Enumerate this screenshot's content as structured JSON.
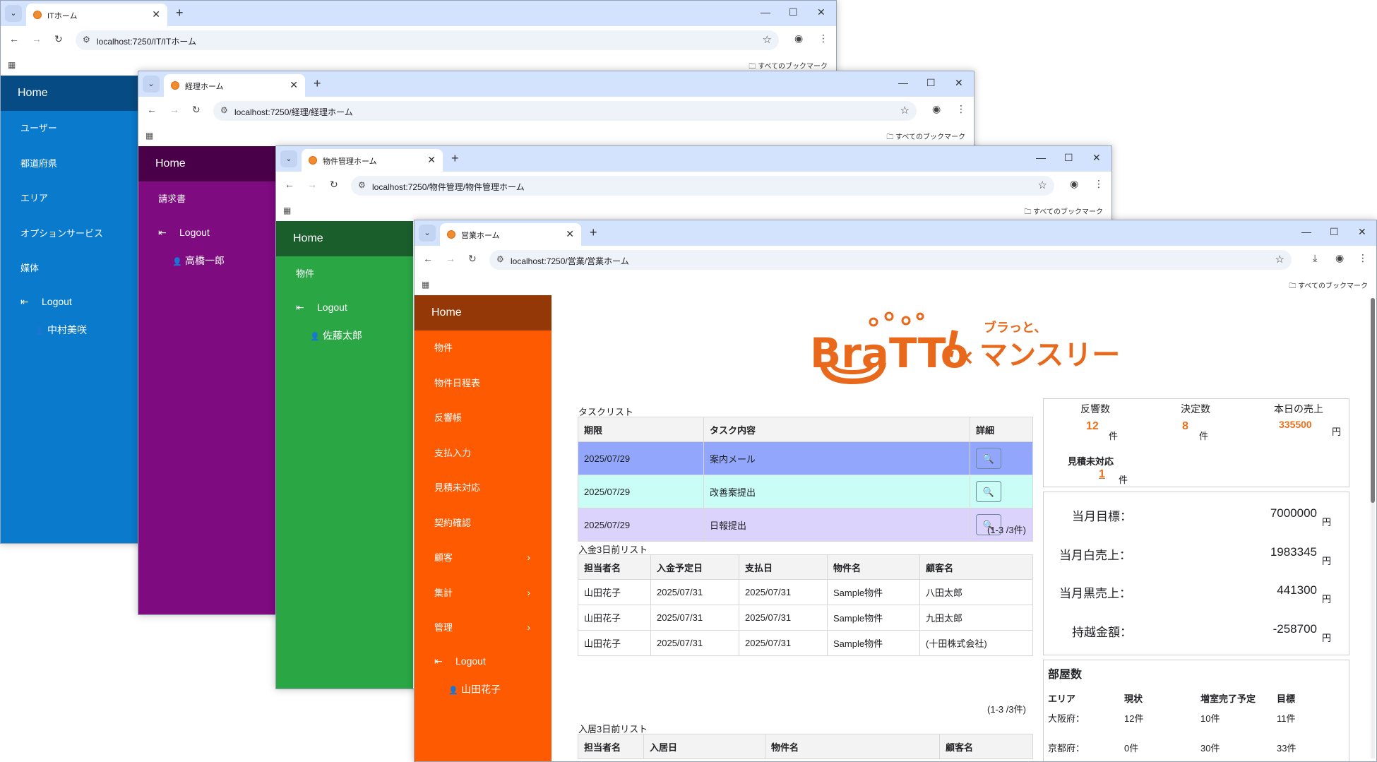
{
  "browser": {
    "bookmarks_label": "すべてのブックマーク",
    "new_tab": "+",
    "close": "✕",
    "minimize": "—",
    "maximize": "☐",
    "window_close": "✕",
    "dropdown": "⌄"
  },
  "windows": [
    {
      "tab_title": "ITホーム",
      "url": "localhost:7250/IT/ITホーム",
      "sidebar_color": "#0a7acc",
      "home_color": "#074b84",
      "home": "Home",
      "items": [
        "ユーザー",
        "都道府県",
        "エリア",
        "オプションサービス",
        "媒体"
      ],
      "logout": "Logout",
      "user": "中村美咲"
    },
    {
      "tab_title": "経理ホーム",
      "url": "localhost:7250/経理/経理ホーム",
      "sidebar_color": "#7e0b80",
      "home_color": "#4a0048",
      "home": "Home",
      "items": [
        "請求書"
      ],
      "logout": "Logout",
      "user": "高橋一郎"
    },
    {
      "tab_title": "物件管理ホーム",
      "url": "localhost:7250/物件管理/物件管理ホーム",
      "sidebar_color": "#2aa645",
      "home_color": "#1a5e2c",
      "home": "Home",
      "items": [
        "物件"
      ],
      "logout": "Logout",
      "user": "佐藤太郎"
    },
    {
      "tab_title": "営業ホーム",
      "url": "localhost:7250/営業/営業ホーム",
      "sidebar_color": "#fe5a02",
      "home_color": "#933806",
      "home": "Home",
      "items": [
        "物件",
        "物件日程表",
        "反響帳",
        "支払入力",
        "見積未対応",
        "契約確認"
      ],
      "expandable_items": [
        "顧客",
        "集計",
        "管理"
      ],
      "logout": "Logout",
      "user": "山田花子"
    }
  ],
  "logo": {
    "brand": "BraTTo",
    "mark": "!",
    "times": "×",
    "tagline": "ブラっと、",
    "product": "マンスリー"
  },
  "task_list": {
    "title": "タスクリスト",
    "headers": [
      "期限",
      "タスク内容",
      "詳細"
    ],
    "rows": [
      {
        "date": "2025/07/29",
        "task": "案内メール",
        "color": "#92a7fc"
      },
      {
        "date": "2025/07/29",
        "task": "改善案提出",
        "color": "#c9fdf5"
      },
      {
        "date": "2025/07/29",
        "task": "日報提出",
        "color": "#dcd3fd"
      }
    ],
    "count": "(1-3 /3件)"
  },
  "payment_list": {
    "title": "入金3日前リスト",
    "headers": [
      "担当者名",
      "入金予定日",
      "支払日",
      "物件名",
      "顧客名"
    ],
    "rows": [
      [
        "山田花子",
        "2025/07/31",
        "2025/07/31",
        "Sample物件",
        "八田太郎"
      ],
      [
        "山田花子",
        "2025/07/31",
        "2025/07/31",
        "Sample物件",
        "九田太郎"
      ],
      [
        "山田花子",
        "2025/07/31",
        "2025/07/31",
        "Sample物件",
        "(十田株式会社)"
      ]
    ],
    "count": "(1-3 /3件)"
  },
  "movein_list": {
    "title": "入居3日前リスト",
    "headers": [
      "担当者名",
      "入居日",
      "物件名",
      "顧客名"
    ]
  },
  "stats": {
    "response_label": "反響数",
    "response_value": "12",
    "response_unit": "件",
    "decided_label": "決定数",
    "decided_value": "8",
    "decided_unit": "件",
    "sales_label": "本日の売上",
    "sales_value": "335500",
    "sales_unit": "円",
    "estimate_label": "見積未対応",
    "estimate_value": "1",
    "estimate_unit": "件"
  },
  "goals": [
    {
      "label": "当月目標：",
      "value": "7000000",
      "unit": "円"
    },
    {
      "label": "当月白売上：",
      "value": "1983345",
      "unit": "円"
    },
    {
      "label": "当月黒売上：",
      "value": "441300",
      "unit": "円"
    },
    {
      "label": "持越金額：",
      "value": "-258700",
      "unit": "円"
    }
  ],
  "rooms": {
    "title": "部屋数",
    "headers": [
      "エリア",
      "現状",
      "増室完了予定",
      "目標"
    ],
    "rows": [
      [
        "大阪府：",
        "12件",
        "10件",
        "11件"
      ],
      [
        "京都府：",
        "0件",
        "30件",
        "33件"
      ]
    ]
  }
}
